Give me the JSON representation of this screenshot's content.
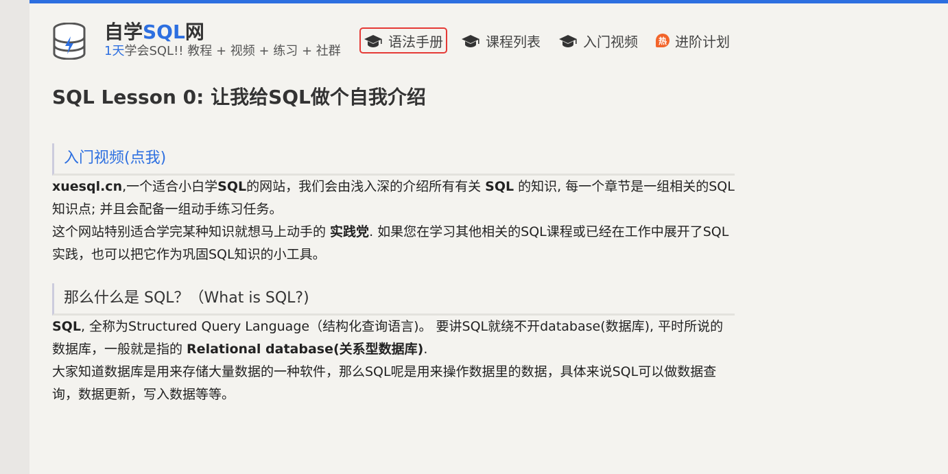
{
  "header": {
    "brand_prefix": "自学",
    "brand_sql": "SQL",
    "brand_suffix": "网",
    "tagline_blue": "1天",
    "tagline_rest": "学会SQL!! 教程 + 视频 + 练习 + 社群"
  },
  "nav": [
    {
      "label": "语法手册",
      "icon": "graduation-cap-icon"
    },
    {
      "label": "课程列表",
      "icon": "graduation-cap-icon"
    },
    {
      "label": "入门视频",
      "icon": "graduation-cap-icon"
    },
    {
      "label": "进阶计划",
      "icon": "hot-icon",
      "icon_text": "热"
    }
  ],
  "main": {
    "title": "SQL Lesson 0: 让我给SQL做个自我介绍",
    "video_link": "入门视频(点我)",
    "p1": {
      "b1": "xuesql.cn",
      "t1": ",一个适合小白学",
      "b2": "SQL",
      "t2": "的网站，我们会由浅入深的介绍所有有关 ",
      "b3": "SQL",
      "t3": " 的知识, 每一个章节是一组相关的SQL知识点; 并且会配备一组动手练习任务。"
    },
    "p2": {
      "t1": "这个网站特别适合学完某种知识就想马上动手的 ",
      "b1": "实践党",
      "t2": ". 如果您在学习其他相关的SQL课程或已经在工作中展开了SQL实践，也可以把它作为巩固SQL知识的小工具。"
    },
    "section2": "那么什么是 SQL？（What is SQL?)",
    "p3": {
      "b1": "SQL",
      "t1": ", 全称为Structured Query Language（结构化查询语言)。 要讲SQL就绕不开database(数据库), 平时所说的数据库，一般就是指的 ",
      "b2": "Relational database(关系型数据库)",
      "t2": "."
    },
    "p4": "大家知道数据库是用来存储大量数据的一种软件，那么SQL呢是用来操作数据里的数据，具体来说SQL可以做数据查询，数据更新，写入数据等等。"
  },
  "colors": {
    "accent": "#2d6fe0",
    "highlight_box": "#e53935",
    "hot_icon": "#f2642a"
  }
}
